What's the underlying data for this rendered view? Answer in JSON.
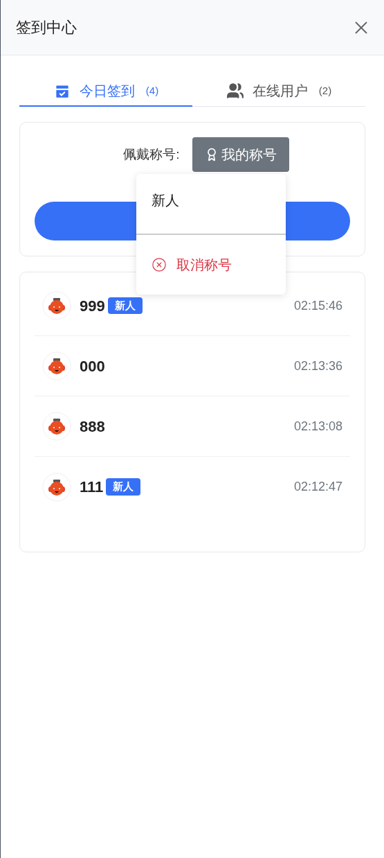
{
  "header": {
    "title": "签到中心"
  },
  "tabs": [
    {
      "label": "今日签到",
      "count": "(4)",
      "selected": true
    },
    {
      "label": "在线用户",
      "count": "(2)",
      "selected": false
    }
  ],
  "title_picker": {
    "label": "佩戴称号:",
    "button": "我的称号"
  },
  "menu": {
    "items": [
      {
        "label": "新人",
        "kind": "option"
      },
      {
        "label": "取消称号",
        "kind": "cancel"
      }
    ]
  },
  "users": [
    {
      "name": "999",
      "badge": "新人",
      "time": "02:15:46"
    },
    {
      "name": "000",
      "time": "02:13:36"
    },
    {
      "name": "888",
      "time": "02:13:08"
    },
    {
      "name": "111",
      "badge": "新人",
      "time": "02:12:47"
    }
  ]
}
